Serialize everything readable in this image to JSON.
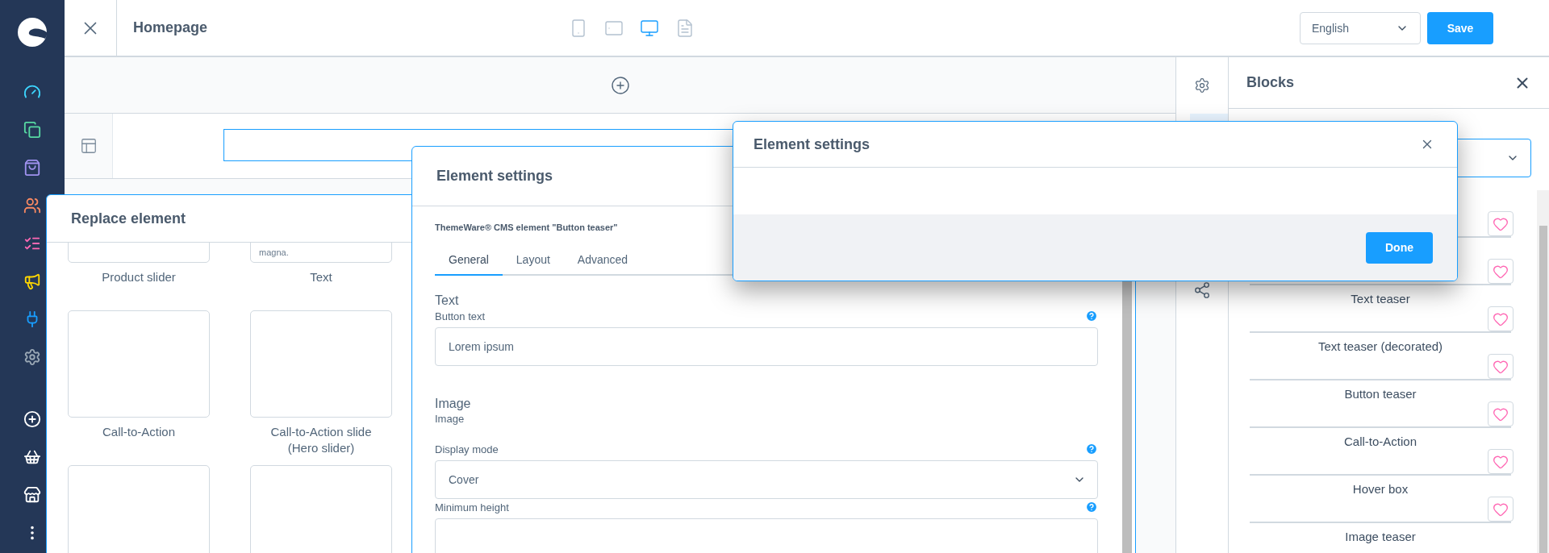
{
  "sidebar": {
    "items": [
      {
        "kind": "dashboard"
      },
      {
        "kind": "catalogue"
      },
      {
        "kind": "orders"
      },
      {
        "kind": "customers"
      },
      {
        "kind": "content"
      },
      {
        "kind": "marketing"
      },
      {
        "kind": "extensions"
      },
      {
        "kind": "settings"
      },
      {
        "kind": "add"
      },
      {
        "kind": "sales-channel"
      },
      {
        "kind": "store"
      },
      {
        "kind": "more"
      }
    ]
  },
  "topbar": {
    "title": "Homepage",
    "devices": [
      {
        "kind": "mobile",
        "selected": false
      },
      {
        "kind": "tablet",
        "selected": false
      },
      {
        "kind": "desktop",
        "selected": true
      },
      {
        "kind": "list",
        "selected": false
      }
    ],
    "language": "English",
    "save": "Save"
  },
  "blocks_panel": {
    "title": "Blocks",
    "items": [
      {
        "favorite": false
      },
      {
        "favorite": false
      },
      {
        "title": "Text teaser",
        "favorite": false
      },
      {
        "title": "Text teaser (decorated)",
        "favorite": false
      },
      {
        "title": "Button teaser",
        "favorite": false
      },
      {
        "title": "Call-to-Action",
        "favorite": false
      },
      {
        "title": "Hover box",
        "favorite": false
      },
      {
        "title": "Image teaser"
      }
    ]
  },
  "replace_dialog": {
    "title": "Replace element",
    "preview_fragment": "magna.",
    "elements": [
      {
        "kind": "card",
        "label": "Product slider"
      },
      {
        "kind": "card",
        "label": "Text"
      },
      {
        "kind": "card",
        "label": "Call-to-Action"
      },
      {
        "kind": "card",
        "label": "Call-to-Action slide (Hero slider)"
      },
      {
        "kind": "card"
      },
      {
        "kind": "card"
      }
    ]
  },
  "settings_dialog": {
    "title": "Element settings",
    "subtitle": "ThemeWare® CMS element \"Button teaser\"",
    "tabs": [
      {
        "label": "General",
        "selected": true
      },
      {
        "label": "Layout",
        "selected": false
      },
      {
        "label": "Advanced",
        "selected": false
      }
    ],
    "fields": [
      {
        "kind": "heading",
        "label": "Text"
      },
      {
        "kind": "input",
        "label": "Button text",
        "value": "Lorem ipsum",
        "help": true
      },
      {
        "kind": "heading",
        "label": "Image"
      },
      {
        "kind": "label",
        "label": "Image"
      },
      {
        "kind": "select",
        "label": "Display mode",
        "value": "Cover",
        "help": true
      },
      {
        "kind": "input",
        "label": "Minimum height",
        "help": true
      }
    ]
  },
  "confirm_dialog": {
    "title": "Element settings",
    "button": "Done"
  }
}
